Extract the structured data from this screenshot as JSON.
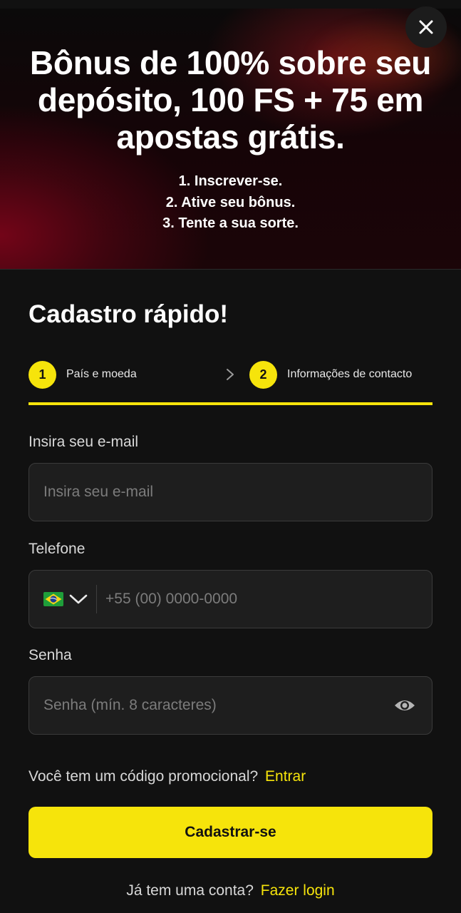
{
  "hero": {
    "title": "Bônus de 100% sobre seu depósito, 100 FS + 75 em apostas grátis.",
    "steps": [
      "1. Inscrever-se.",
      "2. Ative seu bônus.",
      "3. Tente a sua sorte."
    ],
    "close_icon": "close-icon"
  },
  "form": {
    "title": "Cadastro rápido!",
    "stepper": {
      "steps": [
        {
          "number": "1",
          "label": "País e moeda"
        },
        {
          "number": "2",
          "label": "Informações de contacto"
        }
      ],
      "separator_icon": "chevron-right-icon"
    },
    "email": {
      "label": "Insira seu e-mail",
      "placeholder": "Insira seu e-mail",
      "value": ""
    },
    "phone": {
      "label": "Telefone",
      "country_flag_icon": "brazil-flag-icon",
      "placeholder": "+55 (00) 0000-0000",
      "value": ""
    },
    "password": {
      "label": "Senha",
      "placeholder": "Senha (mín. 8 caracteres)",
      "value": "",
      "toggle_icon": "eye-icon"
    },
    "promo": {
      "question": "Você tem um código promocional?",
      "link": "Entrar"
    },
    "submit_label": "Cadastrar-se",
    "login": {
      "question": "Já tem uma conta?",
      "link": "Fazer login"
    }
  },
  "colors": {
    "accent": "#f6e40b",
    "background": "#111111",
    "input_background": "#1e1e1e",
    "input_border": "#3b3b3b"
  }
}
